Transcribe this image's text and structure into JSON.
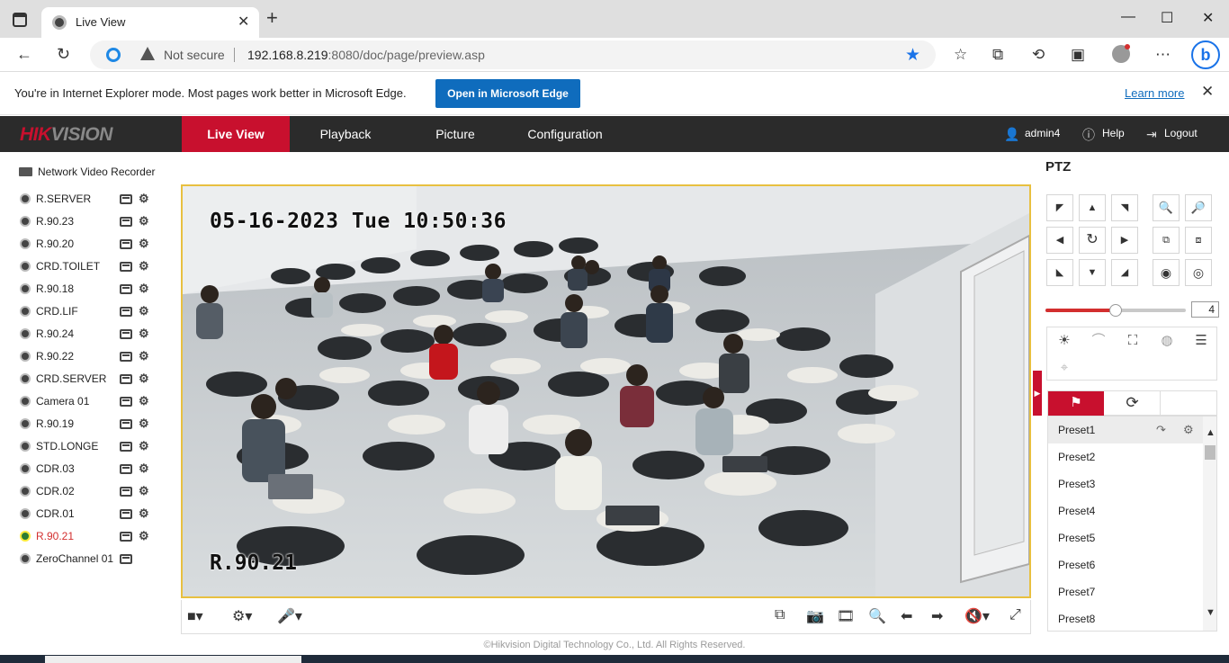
{
  "browser": {
    "tab_title": "Live View",
    "not_secure": "Not secure",
    "url_host": "192.168.8.219",
    "url_rest": ":8080/doc/page/preview.asp",
    "ie_message": "You're in Internet Explorer mode. Most pages work better in Microsoft Edge.",
    "ie_open_button": "Open in Microsoft Edge",
    "ie_learn_more": "Learn more"
  },
  "header": {
    "logo_red": "HIK",
    "logo_grey": "VISION",
    "nav": [
      "Live View",
      "Playback",
      "Picture",
      "Configuration"
    ],
    "active_nav": "Live View",
    "user": "admin4",
    "help": "Help",
    "logout": "Logout",
    "accent_color": "#c8102e"
  },
  "device_tree": {
    "root_label": "Network Video Recorder",
    "cameras": [
      {
        "name": "R.SERVER"
      },
      {
        "name": "R.90.23"
      },
      {
        "name": "R.90.20"
      },
      {
        "name": "CRD.TOILET"
      },
      {
        "name": "R.90.18"
      },
      {
        "name": "CRD.LIF"
      },
      {
        "name": "R.90.24"
      },
      {
        "name": "R.90.22"
      },
      {
        "name": "CRD.SERVER"
      },
      {
        "name": "Camera 01"
      },
      {
        "name": "R.90.19"
      },
      {
        "name": "STD.LONGE"
      },
      {
        "name": "CDR.03"
      },
      {
        "name": "CDR.02"
      },
      {
        "name": "CDR.01"
      },
      {
        "name": "R.90.21",
        "active": true
      },
      {
        "name": "ZeroChannel 01"
      }
    ]
  },
  "video": {
    "osd_timestamp": "05-16-2023 Tue 10:50:36",
    "osd_camera_name": "R.90.21"
  },
  "ptz": {
    "title": "PTZ",
    "speed": "4",
    "speed_fraction": 0.5,
    "presets": [
      "Preset1",
      "Preset2",
      "Preset3",
      "Preset4",
      "Preset5",
      "Preset6",
      "Preset7",
      "Preset8"
    ],
    "selected_preset": "Preset1"
  },
  "footer": "©Hikvision Digital Technology Co., Ltd. All Rights Reserved."
}
